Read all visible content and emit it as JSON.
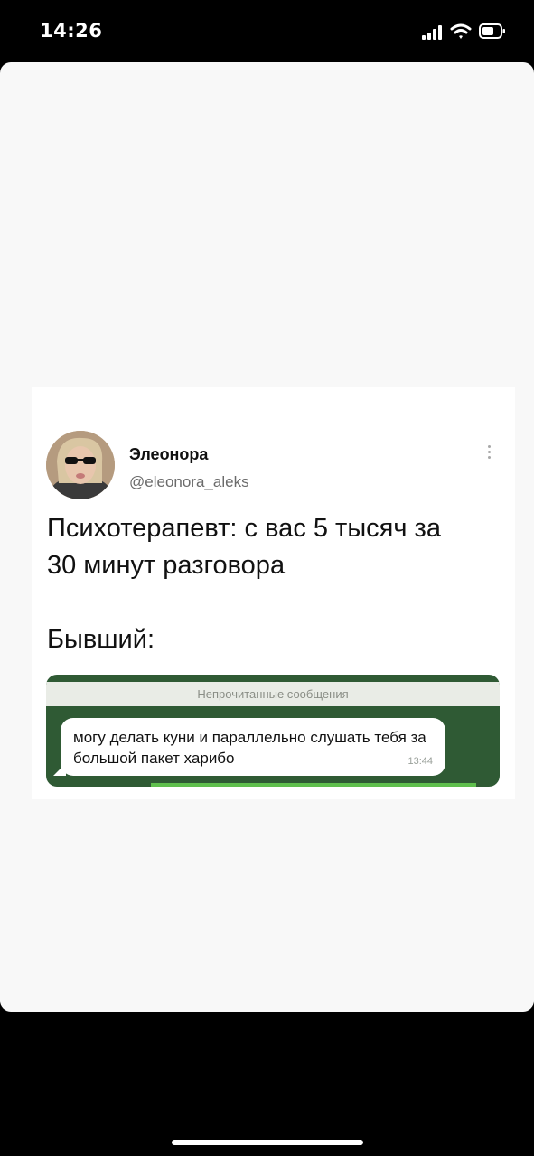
{
  "status_bar": {
    "time": "14:26"
  },
  "tweet": {
    "display_name": "Элеонора",
    "handle": "@eleonora_aleks",
    "text_lines": [
      "Психотерапевт: с вас 5 тысяч за",
      "30 минут разговора",
      "",
      "Бывший:"
    ],
    "chat": {
      "header": "Непрочитанные сообщения",
      "message": "могу делать куни и параллельно  слушать тебя за большой пакет харибо",
      "time": "13:44"
    }
  },
  "colors": {
    "chat_bg": "#2f5a34",
    "accent_green": "#5fbf4d"
  }
}
